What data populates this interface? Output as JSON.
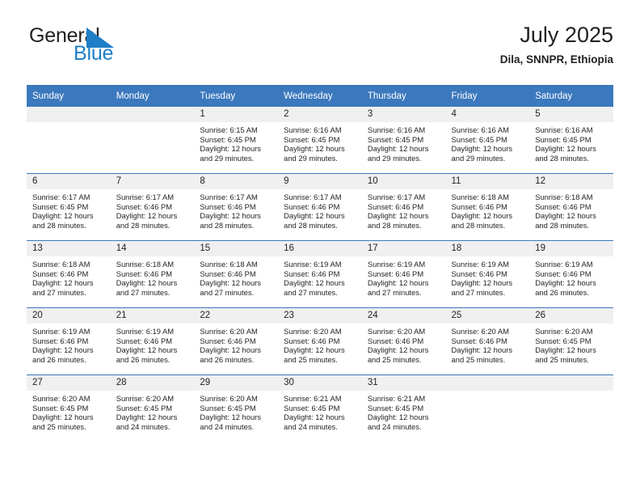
{
  "brand": {
    "name_top": "General",
    "name_bottom": "Blue",
    "flag_icon": "blue-triangle-flag-icon",
    "accent_color": "#1f7ec8"
  },
  "header": {
    "title": "July 2025",
    "subtitle": "Dila, SNNPR, Ethiopia"
  },
  "theme": {
    "header_bg": "#3b78bd",
    "daynum_bg": "#f0f0f0",
    "text": "#231f20"
  },
  "labels": {
    "sunrise_prefix": "Sunrise:",
    "sunset_prefix": "Sunset:",
    "daylight_prefix": "Daylight:"
  },
  "weekdays": [
    "Sunday",
    "Monday",
    "Tuesday",
    "Wednesday",
    "Thursday",
    "Friday",
    "Saturday"
  ],
  "weeks": [
    [
      {
        "day": "",
        "empty": true
      },
      {
        "day": "",
        "empty": true
      },
      {
        "day": "1",
        "sunrise": "Sunrise: 6:15 AM",
        "sunset": "Sunset: 6:45 PM",
        "daylight_l1": "Daylight: 12 hours",
        "daylight_l2": "and 29 minutes."
      },
      {
        "day": "2",
        "sunrise": "Sunrise: 6:16 AM",
        "sunset": "Sunset: 6:45 PM",
        "daylight_l1": "Daylight: 12 hours",
        "daylight_l2": "and 29 minutes."
      },
      {
        "day": "3",
        "sunrise": "Sunrise: 6:16 AM",
        "sunset": "Sunset: 6:45 PM",
        "daylight_l1": "Daylight: 12 hours",
        "daylight_l2": "and 29 minutes."
      },
      {
        "day": "4",
        "sunrise": "Sunrise: 6:16 AM",
        "sunset": "Sunset: 6:45 PM",
        "daylight_l1": "Daylight: 12 hours",
        "daylight_l2": "and 29 minutes."
      },
      {
        "day": "5",
        "sunrise": "Sunrise: 6:16 AM",
        "sunset": "Sunset: 6:45 PM",
        "daylight_l1": "Daylight: 12 hours",
        "daylight_l2": "and 28 minutes."
      }
    ],
    [
      {
        "day": "6",
        "sunrise": "Sunrise: 6:17 AM",
        "sunset": "Sunset: 6:45 PM",
        "daylight_l1": "Daylight: 12 hours",
        "daylight_l2": "and 28 minutes."
      },
      {
        "day": "7",
        "sunrise": "Sunrise: 6:17 AM",
        "sunset": "Sunset: 6:46 PM",
        "daylight_l1": "Daylight: 12 hours",
        "daylight_l2": "and 28 minutes."
      },
      {
        "day": "8",
        "sunrise": "Sunrise: 6:17 AM",
        "sunset": "Sunset: 6:46 PM",
        "daylight_l1": "Daylight: 12 hours",
        "daylight_l2": "and 28 minutes."
      },
      {
        "day": "9",
        "sunrise": "Sunrise: 6:17 AM",
        "sunset": "Sunset: 6:46 PM",
        "daylight_l1": "Daylight: 12 hours",
        "daylight_l2": "and 28 minutes."
      },
      {
        "day": "10",
        "sunrise": "Sunrise: 6:17 AM",
        "sunset": "Sunset: 6:46 PM",
        "daylight_l1": "Daylight: 12 hours",
        "daylight_l2": "and 28 minutes."
      },
      {
        "day": "11",
        "sunrise": "Sunrise: 6:18 AM",
        "sunset": "Sunset: 6:46 PM",
        "daylight_l1": "Daylight: 12 hours",
        "daylight_l2": "and 28 minutes."
      },
      {
        "day": "12",
        "sunrise": "Sunrise: 6:18 AM",
        "sunset": "Sunset: 6:46 PM",
        "daylight_l1": "Daylight: 12 hours",
        "daylight_l2": "and 28 minutes."
      }
    ],
    [
      {
        "day": "13",
        "sunrise": "Sunrise: 6:18 AM",
        "sunset": "Sunset: 6:46 PM",
        "daylight_l1": "Daylight: 12 hours",
        "daylight_l2": "and 27 minutes."
      },
      {
        "day": "14",
        "sunrise": "Sunrise: 6:18 AM",
        "sunset": "Sunset: 6:46 PM",
        "daylight_l1": "Daylight: 12 hours",
        "daylight_l2": "and 27 minutes."
      },
      {
        "day": "15",
        "sunrise": "Sunrise: 6:18 AM",
        "sunset": "Sunset: 6:46 PM",
        "daylight_l1": "Daylight: 12 hours",
        "daylight_l2": "and 27 minutes."
      },
      {
        "day": "16",
        "sunrise": "Sunrise: 6:19 AM",
        "sunset": "Sunset: 6:46 PM",
        "daylight_l1": "Daylight: 12 hours",
        "daylight_l2": "and 27 minutes."
      },
      {
        "day": "17",
        "sunrise": "Sunrise: 6:19 AM",
        "sunset": "Sunset: 6:46 PM",
        "daylight_l1": "Daylight: 12 hours",
        "daylight_l2": "and 27 minutes."
      },
      {
        "day": "18",
        "sunrise": "Sunrise: 6:19 AM",
        "sunset": "Sunset: 6:46 PM",
        "daylight_l1": "Daylight: 12 hours",
        "daylight_l2": "and 27 minutes."
      },
      {
        "day": "19",
        "sunrise": "Sunrise: 6:19 AM",
        "sunset": "Sunset: 6:46 PM",
        "daylight_l1": "Daylight: 12 hours",
        "daylight_l2": "and 26 minutes."
      }
    ],
    [
      {
        "day": "20",
        "sunrise": "Sunrise: 6:19 AM",
        "sunset": "Sunset: 6:46 PM",
        "daylight_l1": "Daylight: 12 hours",
        "daylight_l2": "and 26 minutes."
      },
      {
        "day": "21",
        "sunrise": "Sunrise: 6:19 AM",
        "sunset": "Sunset: 6:46 PM",
        "daylight_l1": "Daylight: 12 hours",
        "daylight_l2": "and 26 minutes."
      },
      {
        "day": "22",
        "sunrise": "Sunrise: 6:20 AM",
        "sunset": "Sunset: 6:46 PM",
        "daylight_l1": "Daylight: 12 hours",
        "daylight_l2": "and 26 minutes."
      },
      {
        "day": "23",
        "sunrise": "Sunrise: 6:20 AM",
        "sunset": "Sunset: 6:46 PM",
        "daylight_l1": "Daylight: 12 hours",
        "daylight_l2": "and 25 minutes."
      },
      {
        "day": "24",
        "sunrise": "Sunrise: 6:20 AM",
        "sunset": "Sunset: 6:46 PM",
        "daylight_l1": "Daylight: 12 hours",
        "daylight_l2": "and 25 minutes."
      },
      {
        "day": "25",
        "sunrise": "Sunrise: 6:20 AM",
        "sunset": "Sunset: 6:46 PM",
        "daylight_l1": "Daylight: 12 hours",
        "daylight_l2": "and 25 minutes."
      },
      {
        "day": "26",
        "sunrise": "Sunrise: 6:20 AM",
        "sunset": "Sunset: 6:45 PM",
        "daylight_l1": "Daylight: 12 hours",
        "daylight_l2": "and 25 minutes."
      }
    ],
    [
      {
        "day": "27",
        "sunrise": "Sunrise: 6:20 AM",
        "sunset": "Sunset: 6:45 PM",
        "daylight_l1": "Daylight: 12 hours",
        "daylight_l2": "and 25 minutes."
      },
      {
        "day": "28",
        "sunrise": "Sunrise: 6:20 AM",
        "sunset": "Sunset: 6:45 PM",
        "daylight_l1": "Daylight: 12 hours",
        "daylight_l2": "and 24 minutes."
      },
      {
        "day": "29",
        "sunrise": "Sunrise: 6:20 AM",
        "sunset": "Sunset: 6:45 PM",
        "daylight_l1": "Daylight: 12 hours",
        "daylight_l2": "and 24 minutes."
      },
      {
        "day": "30",
        "sunrise": "Sunrise: 6:21 AM",
        "sunset": "Sunset: 6:45 PM",
        "daylight_l1": "Daylight: 12 hours",
        "daylight_l2": "and 24 minutes."
      },
      {
        "day": "31",
        "sunrise": "Sunrise: 6:21 AM",
        "sunset": "Sunset: 6:45 PM",
        "daylight_l1": "Daylight: 12 hours",
        "daylight_l2": "and 24 minutes."
      },
      {
        "day": "",
        "empty": true
      },
      {
        "day": "",
        "empty": true
      }
    ]
  ]
}
